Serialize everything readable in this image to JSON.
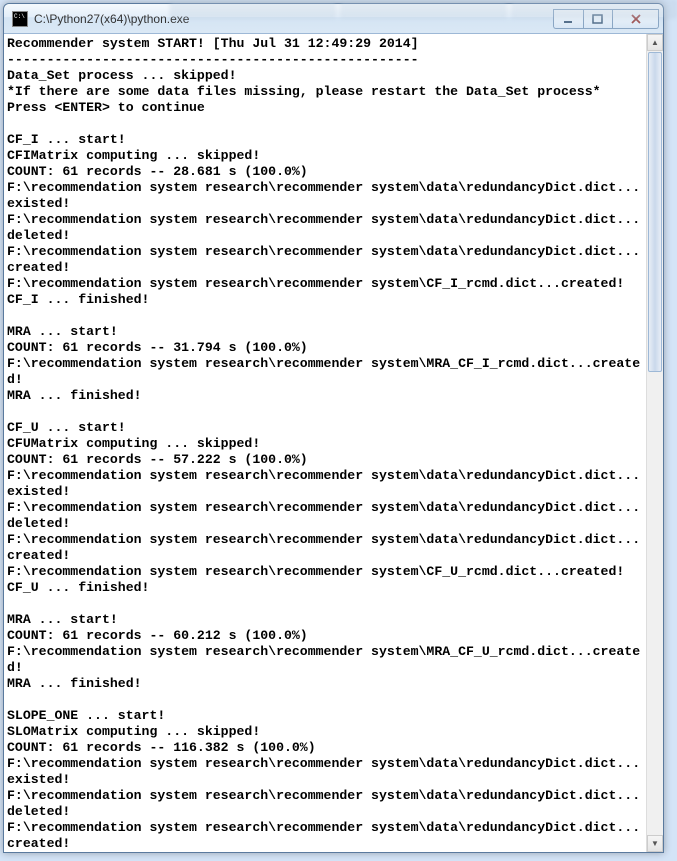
{
  "window": {
    "title": "C:\\Python27(x64)\\python.exe"
  },
  "console": {
    "text": "Recommender system START! [Thu Jul 31 12:49:29 2014]\n----------------------------------------------------\nData_Set process ... skipped!\n*If there are some data files missing, please restart the Data_Set process*\nPress <ENTER> to continue\n\nCF_I ... start!\nCFIMatrix computing ... skipped!\nCOUNT: 61 records -- 28.681 s (100.0%)\nF:\\recommendation system research\\recommender system\\data\\redundancyDict.dict...existed!\nF:\\recommendation system research\\recommender system\\data\\redundancyDict.dict...deleted!\nF:\\recommendation system research\\recommender system\\data\\redundancyDict.dict...created!\nF:\\recommendation system research\\recommender system\\CF_I_rcmd.dict...created!\nCF_I ... finished!\n\nMRA ... start!\nCOUNT: 61 records -- 31.794 s (100.0%)\nF:\\recommendation system research\\recommender system\\MRA_CF_I_rcmd.dict...created!\nMRA ... finished!\n\nCF_U ... start!\nCFUMatrix computing ... skipped!\nCOUNT: 61 records -- 57.222 s (100.0%)\nF:\\recommendation system research\\recommender system\\data\\redundancyDict.dict...existed!\nF:\\recommendation system research\\recommender system\\data\\redundancyDict.dict...deleted!\nF:\\recommendation system research\\recommender system\\data\\redundancyDict.dict...created!\nF:\\recommendation system research\\recommender system\\CF_U_rcmd.dict...created!\nCF_U ... finished!\n\nMRA ... start!\nCOUNT: 61 records -- 60.212 s (100.0%)\nF:\\recommendation system research\\recommender system\\MRA_CF_U_rcmd.dict...created!\nMRA ... finished!\n\nSLOPE_ONE ... start!\nSLOMatrix computing ... skipped!\nCOUNT: 61 records -- 116.382 s (100.0%)\nF:\\recommendation system research\\recommender system\\data\\redundancyDict.dict...existed!\nF:\\recommendation system research\\recommender system\\data\\redundancyDict.dict...deleted!\nF:\\recommendation system research\\recommender system\\data\\redundancyDict.dict...created!"
  }
}
